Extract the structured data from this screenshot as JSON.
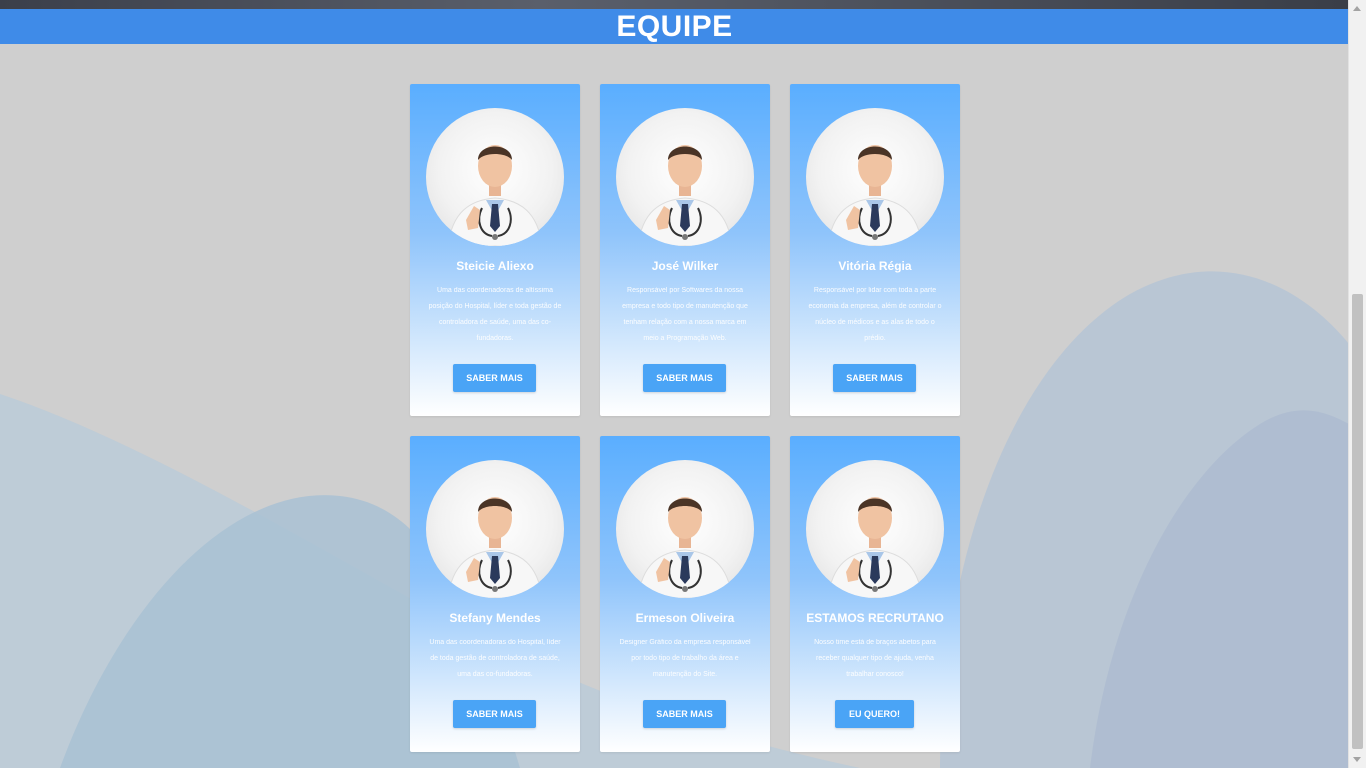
{
  "page": {
    "title": "EQUIPE"
  },
  "team": [
    {
      "name": "Steicie Aliexo",
      "description": "Uma das coordenadoras de altíssima posição do Hospital, líder e toda gestão de controladora de saúde, uma das co-fundadoras.",
      "button": "SABER MAIS"
    },
    {
      "name": "José Wilker",
      "description": "Responsável por Softwares da nossa empresa e todo tipo de manutenção que tenham relação com a nossa marca em meio a Programação Web.",
      "button": "SABER MAIS"
    },
    {
      "name": "Vitória Régia",
      "description": "Responsável por lidar com toda a parte economia da empresa, além de controlar o núcleo de médicos e as alas de todo o prédio.",
      "button": "SABER MAIS"
    },
    {
      "name": "Stefany Mendes",
      "description": "Uma das coordenadoras do Hospital, líder de toda gestão de controladora de saúde, uma das co-fundadoras.",
      "button": "SABER MAIS"
    },
    {
      "name": "Ermeson Oliveira",
      "description": "Designer Gráfico da empresa responsável por todo tipo de trabalho da área e manutenção do Site.",
      "button": "SABER MAIS"
    },
    {
      "name": "ESTAMOS RECRUTANO",
      "description": "Nosso time está de braços abetos para receber qualquer tipo de ajuda, venha trabalhar conosco!",
      "button": "EU QUERO!"
    }
  ],
  "colors": {
    "header": "#3f8be8",
    "button": "#4aa4f6",
    "card_top": "#5aaeff",
    "background": "#cfcfcf"
  },
  "icons": {
    "avatar": "doctor-photo",
    "scroll_up": "arrow-up-icon",
    "scroll_down": "arrow-down-icon"
  }
}
